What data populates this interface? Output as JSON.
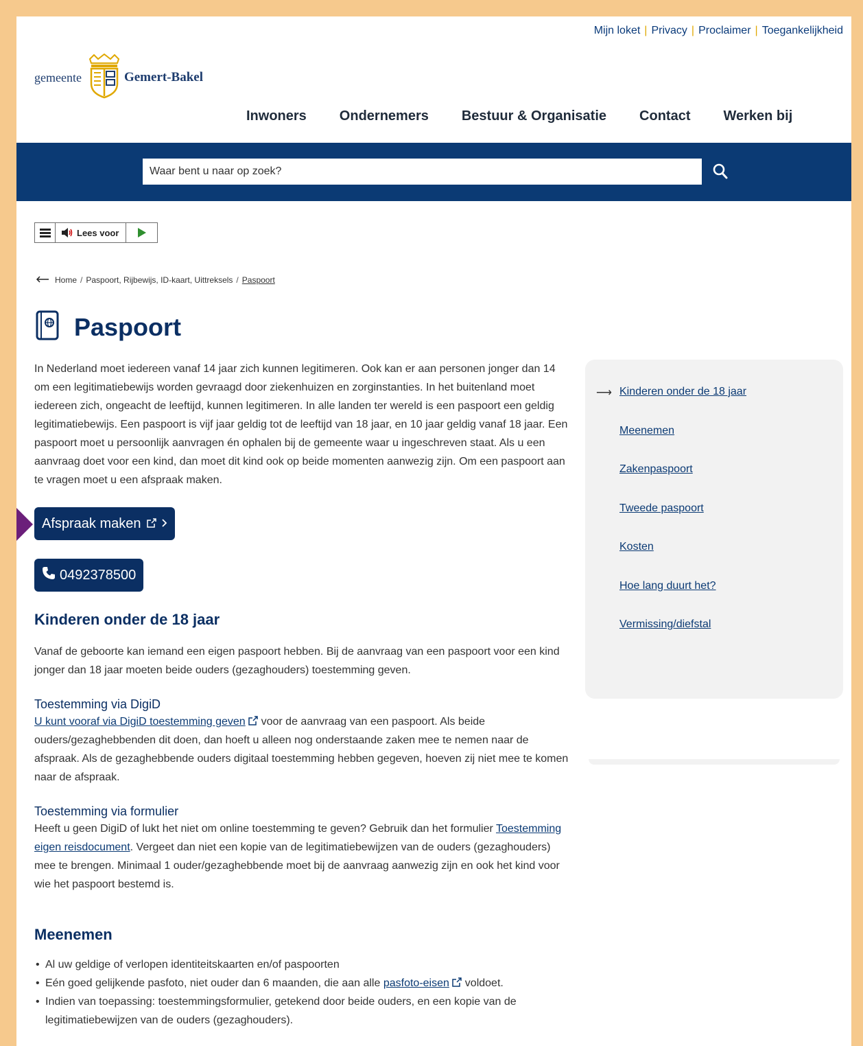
{
  "toplinks": [
    "Mijn loket",
    "Privacy",
    "Proclaimer",
    "Toegankelijkheid"
  ],
  "logo": {
    "prefix": "gemeente",
    "name": "Gemert-Bakel"
  },
  "nav": [
    "Inwoners",
    "Ondernemers",
    "Bestuur & Organisatie",
    "Contact",
    "Werken bij"
  ],
  "search": {
    "placeholder": "Waar bent u naar op zoek?"
  },
  "readspeaker": {
    "label": "Lees voor"
  },
  "breadcrumb": {
    "items": [
      "Home",
      "Paspoort, Rijbewijs, ID-kaart, Uittreksels",
      "Paspoort"
    ]
  },
  "page": {
    "title": "Paspoort",
    "intro": "In Nederland moet iedereen vanaf 14 jaar zich kunnen legitimeren. Ook kan er aan personen jonger dan 14 om een legitimatiebewijs worden gevraagd door ziekenhuizen en zorginstanties. In het buitenland moet iedereen zich, ongeacht de leeftijd, kunnen legitimeren. In alle landen ter wereld is een paspoort een geldig legitimatiebewijs. Een paspoort is vijf jaar geldig tot de leeftijd van 18 jaar, en 10 jaar geldig vanaf 18 jaar. Een paspoort moet u persoonlijk aanvragen én ophalen bij de gemeente waar u ingeschreven staat. Als u een aanvraag doet voor een kind, dan moet dit kind ook op beide momenten aanwezig zijn. Om een paspoort aan te vragen moet u een afspraak maken.",
    "btn_afspraak": "Afspraak maken",
    "btn_phone": "0492378500"
  },
  "sections": {
    "kinderen": {
      "title": "Kinderen onder de 18 jaar",
      "intro": "Vanaf de geboorte kan iemand een eigen paspoort hebben. Bij de aanvraag van een paspoort voor een kind jonger dan 18 jaar moeten beide ouders (gezaghouders) toestemming geven.",
      "digid_title": "Toestemming via DigiD",
      "digid_link": "U kunt vooraf via DigiD toestemming geven",
      "digid_text": " voor de aanvraag van een paspoort. Als beide ouders/gezaghebbenden dit doen, dan hoeft u alleen nog onderstaande zaken mee te nemen naar de afspraak. Als de gezaghebbende ouders digitaal toestemming hebben gegeven, hoeven zij niet mee te komen naar de afspraak.",
      "form_title": "Toestemming via formulier",
      "form_text_1": "Heeft u geen DigiD of lukt het niet om online toestemming te geven? Gebruik dan het formulier ",
      "form_link": "Toestemming eigen reisdocument",
      "form_text_2": ". Vergeet dan niet een kopie van de legitimatiebewijzen van de ouders (gezaghouders) mee te brengen. Minimaal 1 ouder/gezaghebbende moet bij de aanvraag aanwezig zijn en ook het kind voor wie het paspoort bestemd is."
    },
    "meenemen": {
      "title": "Meenemen",
      "item1": "Al uw geldige of verlopen identiteitskaarten en/of paspoorten",
      "item2_pre": "Eén goed gelijkende pasfoto, niet ouder dan 6 maanden, die aan alle ",
      "item2_link": "pasfoto-eisen",
      "item2_post": " voldoet.",
      "item3": "Indien van toepassing: toestemmingsformulier, getekend door beide ouders, en een kopie van de legitimatiebewijzen van de ouders (gezaghouders)."
    }
  },
  "sidebar": [
    "Kinderen onder de 18 jaar",
    "Meenemen",
    "Zakenpaspoort",
    "Tweede paspoort",
    "Kosten",
    "Hoe lang duurt het?",
    "Vermissing/diefstal"
  ],
  "colors": {
    "brand_blue": "#0b3a74",
    "accent_yellow": "#e0a800",
    "frame_orange": "#f6c98d",
    "pointer_purple": "#6b1f7a"
  }
}
